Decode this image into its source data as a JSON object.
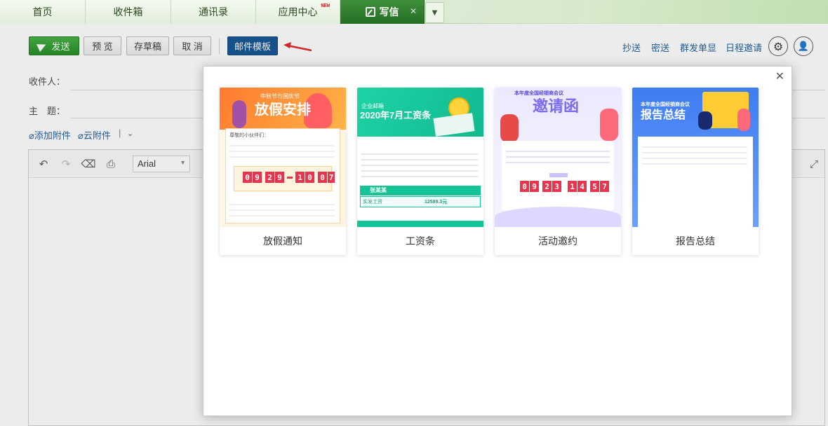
{
  "tabs": [
    {
      "label": "首页"
    },
    {
      "label": "收件箱"
    },
    {
      "label": "通讯录"
    },
    {
      "label": "应用中心",
      "badge": "NEW"
    },
    {
      "label": "写信",
      "active": true
    }
  ],
  "toolbar": {
    "send": "发送",
    "preview": "预 览",
    "draft": "存草稿",
    "cancel": "取 消",
    "template": "邮件模板",
    "links": [
      "抄送",
      "密送",
      "群发单显",
      "日程邀请"
    ]
  },
  "form": {
    "to_label": "收件人：",
    "subject_label": "主　题：",
    "attach": "添加附件",
    "cloud": "云附件",
    "sep": "|"
  },
  "editor": {
    "font": "Arial"
  },
  "modal": {
    "templates": [
      {
        "label": "放假通知",
        "banner_top": "中秋节与国庆节",
        "banner_title": "放假安排",
        "digits_a": "0929",
        "digits_b": "1007",
        "body": "尊敬的小伙伴们："
      },
      {
        "label": "工资条",
        "tag": "企业邮箱",
        "title": "2020年7月工资条",
        "name": "张某某",
        "row_label": "实发工资",
        "row_value": "12589.3元"
      },
      {
        "label": "活动邀约",
        "top": "本年度全国经销商会议",
        "title": "邀请函",
        "digits": "092314 57"
      },
      {
        "label": "报告总结",
        "top": "本年度全国经销商会议",
        "title": "报告总结"
      }
    ]
  },
  "colors": {
    "green": "#2a8a2a",
    "blue_button": "#0d4f91",
    "link": "#1a5b9c"
  }
}
